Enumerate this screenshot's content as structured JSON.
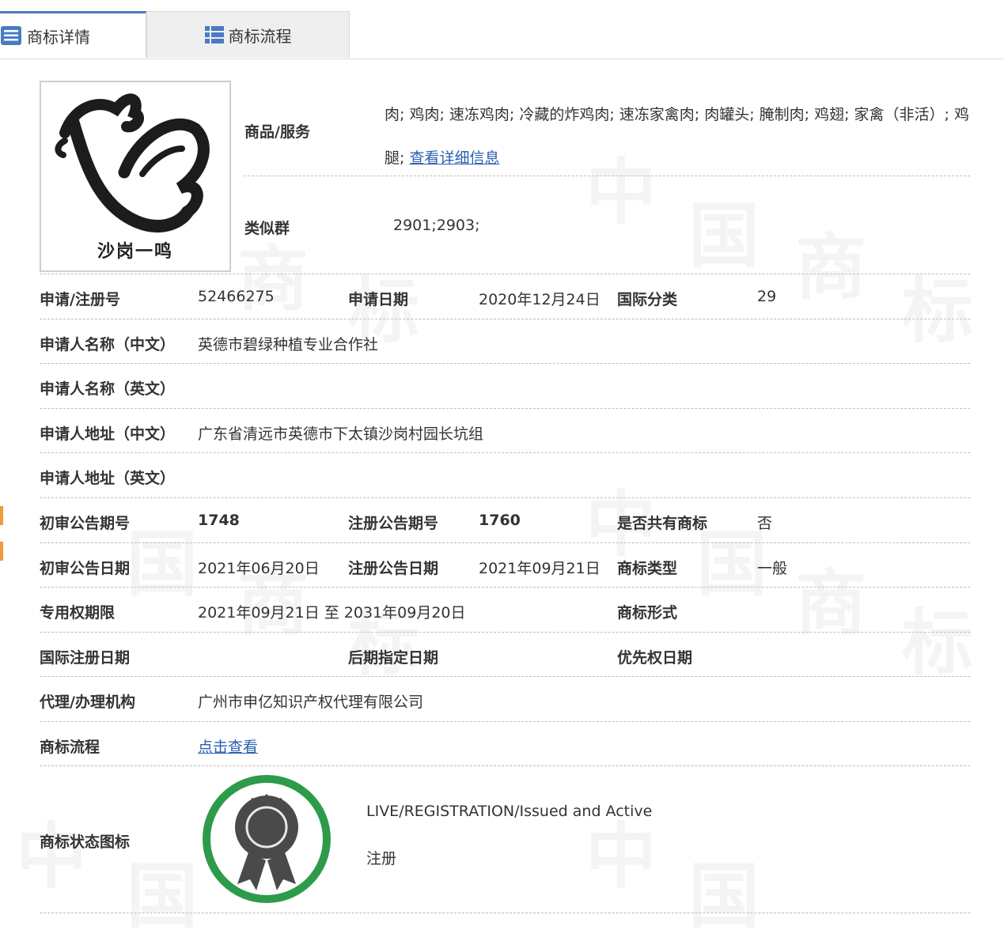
{
  "tabs": [
    {
      "label": "商标详情",
      "active": true
    },
    {
      "label": "商标流程",
      "active": false
    }
  ],
  "goods": {
    "label": "商品/服务",
    "text": "肉; 鸡肉; 速冻鸡肉; 冷藏的炸鸡肉; 速冻家禽肉; 肉罐头; 腌制肉; 鸡翅; 家禽（非活）; 鸡腿;",
    "link": "查看详细信息"
  },
  "similar_group": {
    "label": "类似群",
    "value": "2901;2903;"
  },
  "logo": {
    "text": "沙岗一鸣"
  },
  "fields": {
    "reg_no_label": "申请/注册号",
    "reg_no": "52466275",
    "app_date_label": "申请日期",
    "app_date": "2020年12月24日",
    "intl_class_label": "国际分类",
    "intl_class": "29",
    "applicant_cn_label": "申请人名称（中文）",
    "applicant_cn": "英德市碧绿种植专业合作社",
    "applicant_en_label": "申请人名称（英文）",
    "address_cn_label": "申请人地址（中文）",
    "address_cn": "广东省清远市英德市下太镇沙岗村园长坑组",
    "address_en_label": "申请人地址（英文）",
    "prelim_issue_label": "初审公告期号",
    "prelim_issue": "1748",
    "reg_issue_label": "注册公告期号",
    "reg_issue": "1760",
    "shared_label": "是否共有商标",
    "shared": "否",
    "prelim_date_label": "初审公告日期",
    "prelim_date": "2021年06月20日",
    "reg_date_label": "注册公告日期",
    "reg_date": "2021年09月21日",
    "tm_type_label": "商标类型",
    "tm_type": "一般",
    "exclusive_label": "专用权期限",
    "exclusive": "2021年09月21日 至 2031年09月20日",
    "tm_form_label": "商标形式",
    "intl_reg_date_label": "国际注册日期",
    "later_date_label": "后期指定日期",
    "priority_date_label": "优先权日期",
    "agent_label": "代理/办理机构",
    "agent": "广州市申亿知识产权代理有限公司",
    "process_label": "商标流程",
    "process_link": "点击查看",
    "status_label": "商标状态图标",
    "status_en": "LIVE/REGISTRATION/Issued and Active",
    "status_cn": "注册"
  },
  "colors": {
    "accent": "#4a7bc4",
    "link": "#2a5fb0",
    "status_ring": "#2e9b4a",
    "badge": "#4a4a4a"
  }
}
